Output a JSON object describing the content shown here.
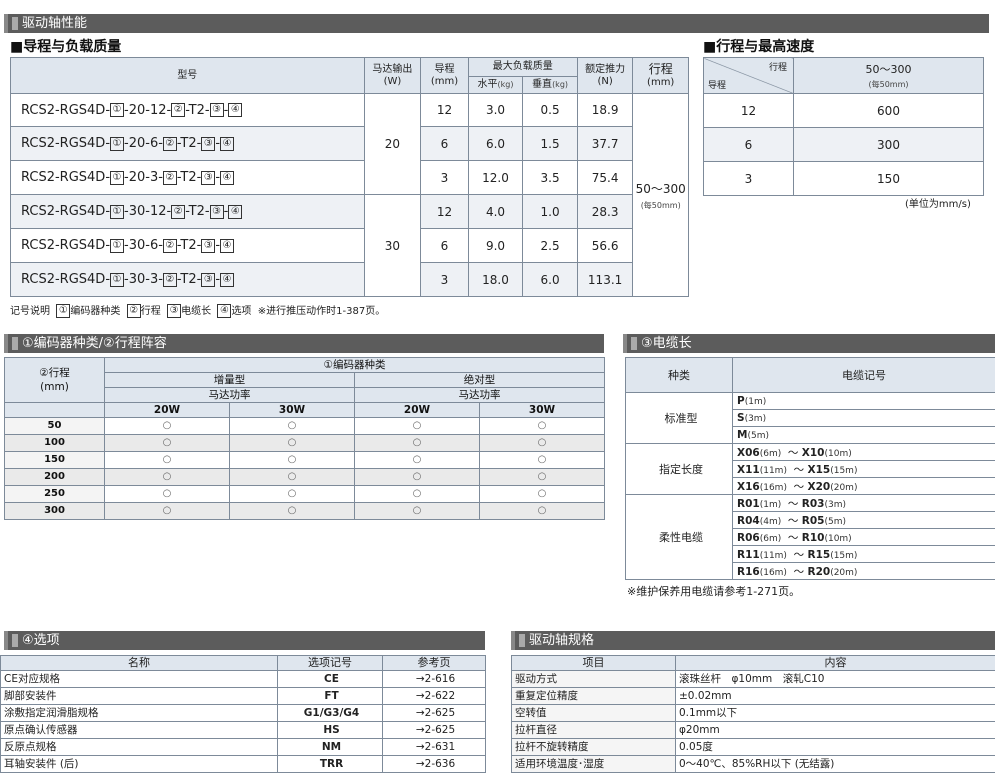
{
  "section_drive": "驱动轴性能",
  "lead_title": "导程与负载质量",
  "speed_title": "行程与最高速度",
  "lead_table": {
    "h_model": "型号",
    "h_motor": "马达输出",
    "h_motor_u": "(W)",
    "h_lead": "导程",
    "h_lead_u": "(mm)",
    "h_load": "最大负载质量",
    "h_horiz": "水平",
    "h_vert": "垂直",
    "h_kg": "(kg)",
    "h_thrust": "额定推力",
    "h_thrust_u": "(N)",
    "h_stroke": "行程",
    "h_stroke_u": "(mm)",
    "stroke_val": "50～300",
    "stroke_step": "(每50mm)",
    "b1": "①",
    "b2": "②",
    "b3": "③",
    "b4": "④",
    "rows": [
      {
        "pre": "RCS2-RGS4D-",
        "mid": "-20-12-",
        "t2": "-T2-",
        "dash": "-",
        "lead": "12",
        "h": "3.0",
        "v": "0.5",
        "n": "18.9"
      },
      {
        "pre": "RCS2-RGS4D-",
        "mid": "-20-6-",
        "t2": "-T2-",
        "dash": "-",
        "lead": "6",
        "h": "6.0",
        "v": "1.5",
        "n": "37.7"
      },
      {
        "pre": "RCS2-RGS4D-",
        "mid": "-20-3-",
        "t2": "-T2-",
        "dash": "-",
        "lead": "3",
        "h": "12.0",
        "v": "3.5",
        "n": "75.4"
      },
      {
        "pre": "RCS2-RGS4D-",
        "mid": "-30-12-",
        "t2": "-T2-",
        "dash": "-",
        "lead": "12",
        "h": "4.0",
        "v": "1.0",
        "n": "28.3"
      },
      {
        "pre": "RCS2-RGS4D-",
        "mid": "-30-6-",
        "t2": "-T2-",
        "dash": "-",
        "lead": "6",
        "h": "9.0",
        "v": "2.5",
        "n": "56.6"
      },
      {
        "pre": "RCS2-RGS4D-",
        "mid": "-30-3-",
        "t2": "-T2-",
        "dash": "-",
        "lead": "3",
        "h": "18.0",
        "v": "6.0",
        "n": "113.1"
      }
    ],
    "motor20": "20",
    "motor30": "30"
  },
  "legend": {
    "prefix": "记号说明",
    "b1": "①",
    "l1": "编码器种类",
    "b2": "②",
    "l2": "行程",
    "b3": "③",
    "l3": "电缆长",
    "b4": "④",
    "l4": "选项",
    "note": "※进行推压动作时1-387页。"
  },
  "speed_table": {
    "h_stroke": "行程",
    "h_lead": "导程",
    "h_range": "50～300",
    "h_step": "(每50mm)",
    "rows": [
      {
        "lead": "12",
        "speed": "600"
      },
      {
        "lead": "6",
        "speed": "300"
      },
      {
        "lead": "3",
        "speed": "150"
      }
    ],
    "unit": "(单位为mm/s)"
  },
  "section_enc": "①编码器种类/②行程阵容",
  "enc_table": {
    "h_stroke": "②行程",
    "h_stroke_u": "(mm)",
    "h_enc": "①编码器种类",
    "h_inc": "增量型",
    "h_abs": "绝对型",
    "h_power": "马达功率",
    "w20": "20W",
    "w30": "30W",
    "rows": [
      {
        "s": "50",
        "m": "○"
      },
      {
        "s": "100",
        "m": "○"
      },
      {
        "s": "150",
        "m": "○"
      },
      {
        "s": "200",
        "m": "○"
      },
      {
        "s": "250",
        "m": "○"
      },
      {
        "s": "300",
        "m": "○"
      }
    ]
  },
  "section_cable": "③电缆长",
  "cable_table": {
    "h_type": "种类",
    "h_code": "电缆记号",
    "std": "标准型",
    "fixed": "指定长度",
    "flex": "柔性电缆",
    "tilde": "～",
    "std_rows": [
      {
        "c": "P",
        "u": "(1m)"
      },
      {
        "c": "S",
        "u": "(3m)"
      },
      {
        "c": "M",
        "u": "(5m)"
      }
    ],
    "fixed_rows": [
      {
        "a": "X06",
        "au": "(6m)",
        "b": "X10",
        "bu": "(10m)"
      },
      {
        "a": "X11",
        "au": "(11m)",
        "b": "X15",
        "bu": "(15m)"
      },
      {
        "a": "X16",
        "au": "(16m)",
        "b": "X20",
        "bu": "(20m)"
      }
    ],
    "flex_rows": [
      {
        "a": "R01",
        "au": "(1m)",
        "b": "R03",
        "bu": "(3m)"
      },
      {
        "a": "R04",
        "au": "(4m)",
        "b": "R05",
        "bu": "(5m)"
      },
      {
        "a": "R06",
        "au": "(6m)",
        "b": "R10",
        "bu": "(10m)"
      },
      {
        "a": "R11",
        "au": "(11m)",
        "b": "R15",
        "bu": "(15m)"
      },
      {
        "a": "R16",
        "au": "(16m)",
        "b": "R20",
        "bu": "(20m)"
      }
    ],
    "note": "※维护保养用电缆请参考1-271页。"
  },
  "section_opt": "④选项",
  "opt_table": {
    "h_name": "名称",
    "h_code": "选项记号",
    "h_ref": "参考页",
    "rows": [
      {
        "n": "CE对应规格",
        "c": "CE",
        "r": "→2-616"
      },
      {
        "n": "脚部安装件",
        "c": "FT",
        "r": "→2-622"
      },
      {
        "n": "涂敷指定润滑脂规格",
        "c": "G1/G3/G4",
        "r": "→2-625"
      },
      {
        "n": "原点确认传感器",
        "c": "HS",
        "r": "→2-625"
      },
      {
        "n": "反原点规格",
        "c": "NM",
        "r": "→2-631"
      },
      {
        "n": "耳轴安装件 (后)",
        "c": "TRR",
        "r": "→2-636"
      }
    ]
  },
  "section_spec": "驱动轴规格",
  "spec_table": {
    "h_item": "项目",
    "h_content": "内容",
    "rows": [
      {
        "i": "驱动方式",
        "c": "滚珠丝杆　φ10mm　滚轧C10"
      },
      {
        "i": "重复定位精度",
        "c": "±0.02mm"
      },
      {
        "i": "空转值",
        "c": "0.1mm以下"
      },
      {
        "i": "拉杆直径",
        "c": "φ20mm"
      },
      {
        "i": "拉杆不旋转精度",
        "c": "0.05度"
      },
      {
        "i": "适用环境温度･湿度",
        "c": "0～40℃、85%RH以下 (无结露)"
      }
    ]
  }
}
